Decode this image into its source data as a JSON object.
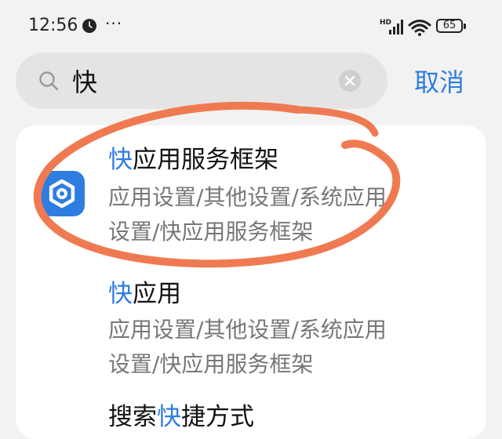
{
  "status_bar": {
    "time": "12:56",
    "more": "···",
    "network": "HD",
    "battery": "65"
  },
  "search": {
    "query": "快",
    "cancel_label": "取消"
  },
  "results": [
    {
      "title_highlight": "快",
      "title_rest": "应用服务框架",
      "path_line1": "应用设置/其他设置/系统应用",
      "path_line2": "设置/快应用服务框架",
      "icon": "hexagon-settings-icon",
      "icon_color": "#2e7de0"
    },
    {
      "title_highlight": "快",
      "title_rest": "应用",
      "path_line1": "应用设置/其他设置/系统应用",
      "path_line2": "设置/快应用服务框架"
    },
    {
      "title_pre": "搜索",
      "title_highlight": "快",
      "title_rest": "捷方式"
    }
  ],
  "colors": {
    "accent": "#2f7de1",
    "annotation": "#ef7a52"
  }
}
